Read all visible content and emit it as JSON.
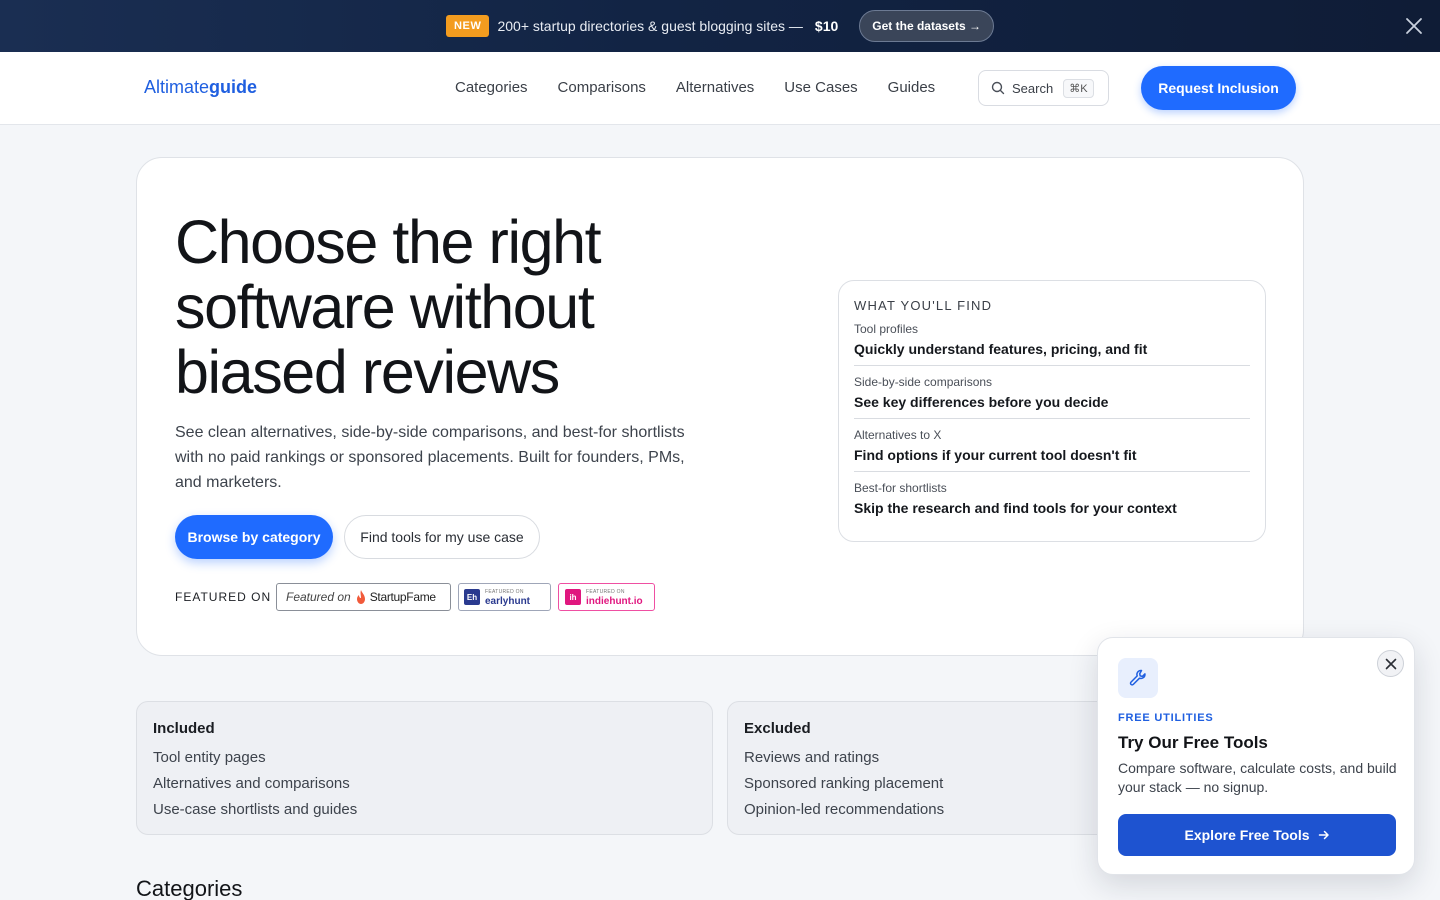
{
  "banner": {
    "badge": "NEW",
    "text": "200+ startup directories & guest blogging sites —",
    "price": "$10",
    "cta": "Get the datasets →"
  },
  "nav": {
    "logo_light": "Altimate",
    "logo_bold": "guide",
    "links": [
      "Categories",
      "Comparisons",
      "Alternatives",
      "Use Cases",
      "Guides"
    ],
    "search_label": "Search",
    "search_shortcut": "⌘K",
    "cta": "Request Inclusion"
  },
  "hero": {
    "title": "Choose the right software without biased reviews",
    "subtitle": "See clean alternatives, side-by-side comparisons, and best-for shortlists with no paid rankings or sponsored placements. Built for founders, PMs, and marketers.",
    "primary_cta": "Browse by category",
    "secondary_cta": "Find tools for my use case",
    "featured_label": "FEATURED ON",
    "featured_badges": [
      {
        "prefix": "Featured on",
        "name": "StartupFame"
      },
      {
        "small": "FEATURED ON",
        "name": "earlyhunt",
        "mark": "Eh"
      },
      {
        "small": "FEATURED ON",
        "name": "indiehunt.io",
        "mark": "ih"
      }
    ]
  },
  "find": {
    "title": "WHAT YOU'LL FIND",
    "items": [
      {
        "label": "Tool profiles",
        "value": "Quickly understand features, pricing, and fit"
      },
      {
        "label": "Side-by-side comparisons",
        "value": "See key differences before you decide"
      },
      {
        "label": "Alternatives to X",
        "value": "Find options if your current tool doesn't fit"
      },
      {
        "label": "Best-for shortlists",
        "value": "Skip the research and find tools for your context"
      }
    ]
  },
  "included": {
    "title": "Included",
    "items": [
      "Tool entity pages",
      "Alternatives and comparisons",
      "Use-case shortlists and guides"
    ]
  },
  "excluded": {
    "title": "Excluded",
    "items": [
      "Reviews and ratings",
      "Sponsored ranking placement",
      "Opinion-led recommendations"
    ]
  },
  "categories_heading": "Categories",
  "popup": {
    "eyebrow": "FREE UTILITIES",
    "title": "Try Our Free Tools",
    "description": "Compare software, calculate costs, and build your stack — no signup.",
    "cta": "Explore Free Tools"
  },
  "colors": {
    "accent": "#1f6bff",
    "popup_button": "#1e53d0",
    "banner_bg": "#122444",
    "new_badge": "#f39c1f",
    "indiehunt": "#e0177f",
    "earlyhunt": "#2a3a8f"
  },
  "icons": [
    "close-icon",
    "search-icon",
    "flame-icon",
    "wrench-icon",
    "arrow-right-icon"
  ]
}
